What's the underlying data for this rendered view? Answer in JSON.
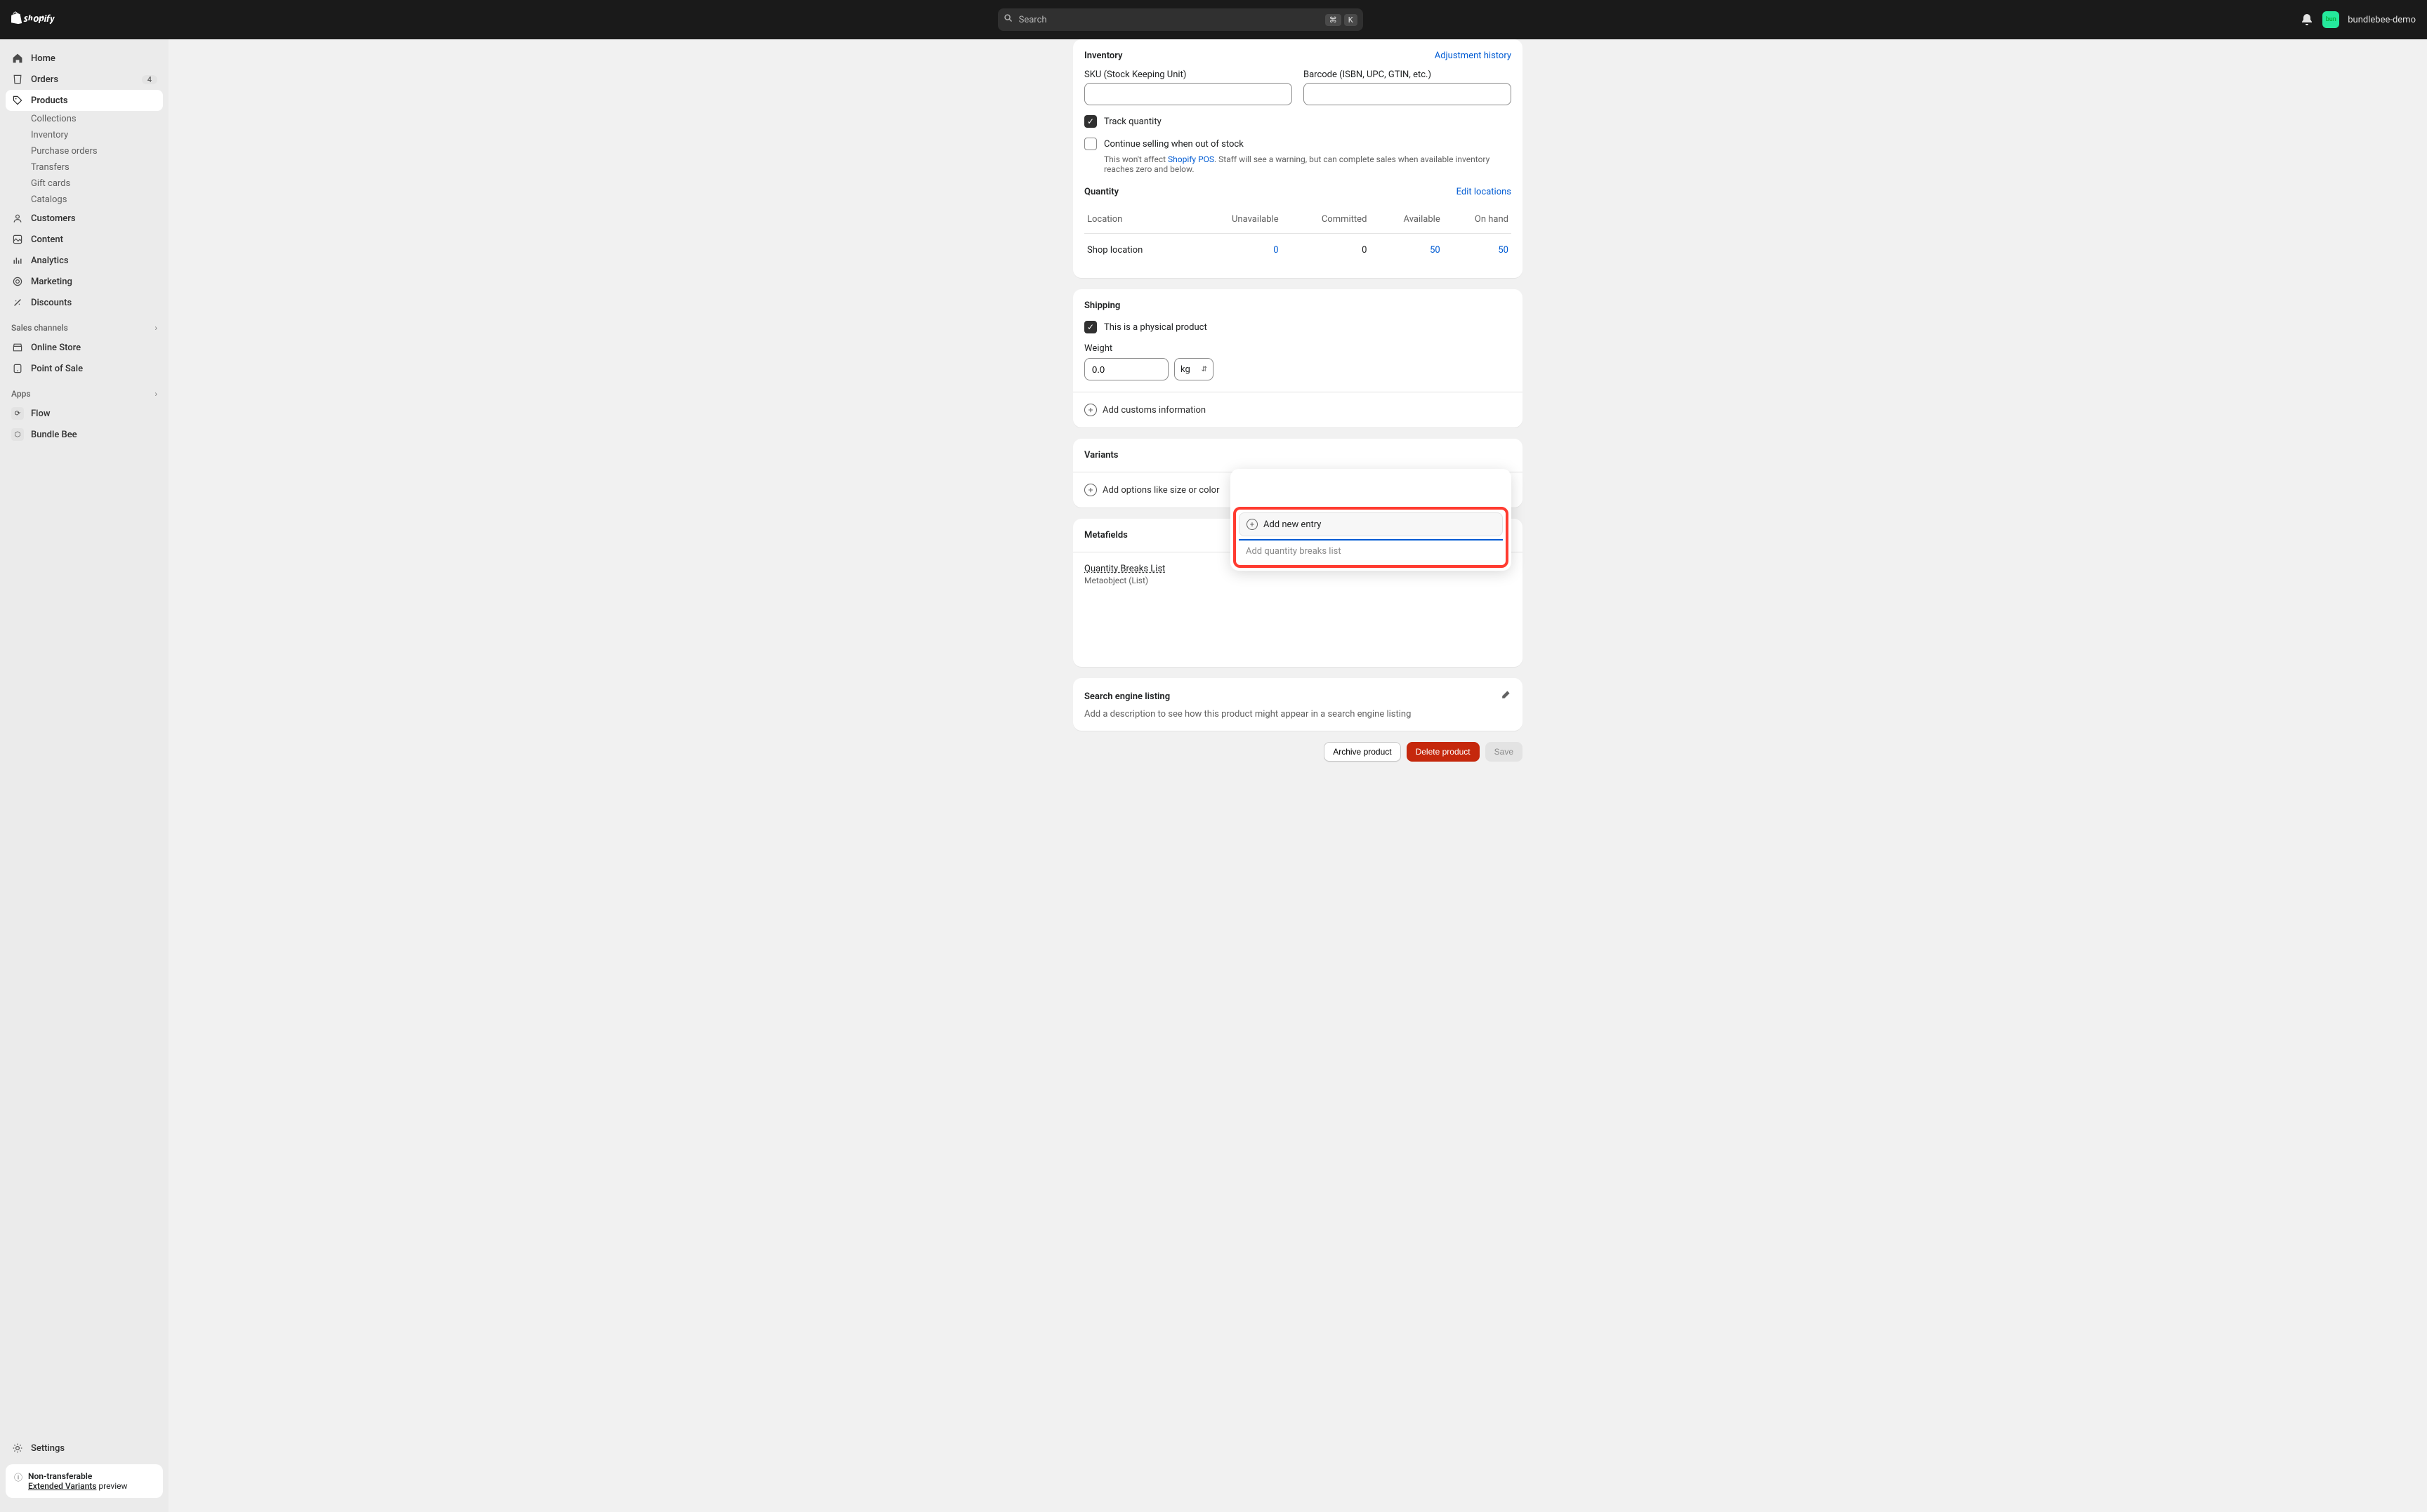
{
  "topbar": {
    "search_placeholder": "Search",
    "kbd1": "⌘",
    "kbd2": "K",
    "avatar_text": "bun",
    "store_name": "bundlebee-demo"
  },
  "sidebar": {
    "home": "Home",
    "orders": "Orders",
    "orders_badge": "4",
    "products": "Products",
    "collections": "Collections",
    "inventory": "Inventory",
    "purchase_orders": "Purchase orders",
    "transfers": "Transfers",
    "gift_cards": "Gift cards",
    "catalogs": "Catalogs",
    "customers": "Customers",
    "content": "Content",
    "analytics": "Analytics",
    "marketing": "Marketing",
    "discounts": "Discounts",
    "sales_channels": "Sales channels",
    "online_store": "Online Store",
    "point_of_sale": "Point of Sale",
    "apps": "Apps",
    "flow": "Flow",
    "bundle_bee": "Bundle Bee",
    "settings": "Settings",
    "preview_title": "Non-transferable",
    "preview_link": "Extended Variants",
    "preview_suffix": " preview"
  },
  "inventory": {
    "title": "Inventory",
    "adjustment_history": "Adjustment history",
    "sku_label": "SKU (Stock Keeping Unit)",
    "barcode_label": "Barcode (ISBN, UPC, GTIN, etc.)",
    "track_quantity": "Track quantity",
    "continue_selling": "Continue selling when out of stock",
    "help_prefix": "This won't affect ",
    "help_link": "Shopify POS",
    "help_suffix": ". Staff will see a warning, but can complete sales when available inventory reaches zero and below.",
    "quantity": "Quantity",
    "edit_locations": "Edit locations",
    "col_location": "Location",
    "col_unavailable": "Unavailable",
    "col_committed": "Committed",
    "col_available": "Available",
    "col_onhand": "On hand",
    "row_location": "Shop location",
    "row_unavailable": "0",
    "row_committed": "0",
    "row_available": "50",
    "row_onhand": "50"
  },
  "shipping": {
    "title": "Shipping",
    "physical": "This is a physical product",
    "weight_label": "Weight",
    "weight_value": "0.0",
    "unit": "kg",
    "add_customs": "Add customs information"
  },
  "variants": {
    "title": "Variants",
    "add_options": "Add options like size or color"
  },
  "metafields": {
    "title": "Metafields",
    "qbl_label": "Quantity Breaks List",
    "qbl_sub": "Metaobject (List)",
    "add_entry": "Add new entry",
    "placeholder": "Add quantity breaks list"
  },
  "seo": {
    "title": "Search engine listing",
    "desc": "Add a description to see how this product might appear in a search engine listing"
  },
  "footer": {
    "archive": "Archive product",
    "delete": "Delete product",
    "save": "Save"
  }
}
